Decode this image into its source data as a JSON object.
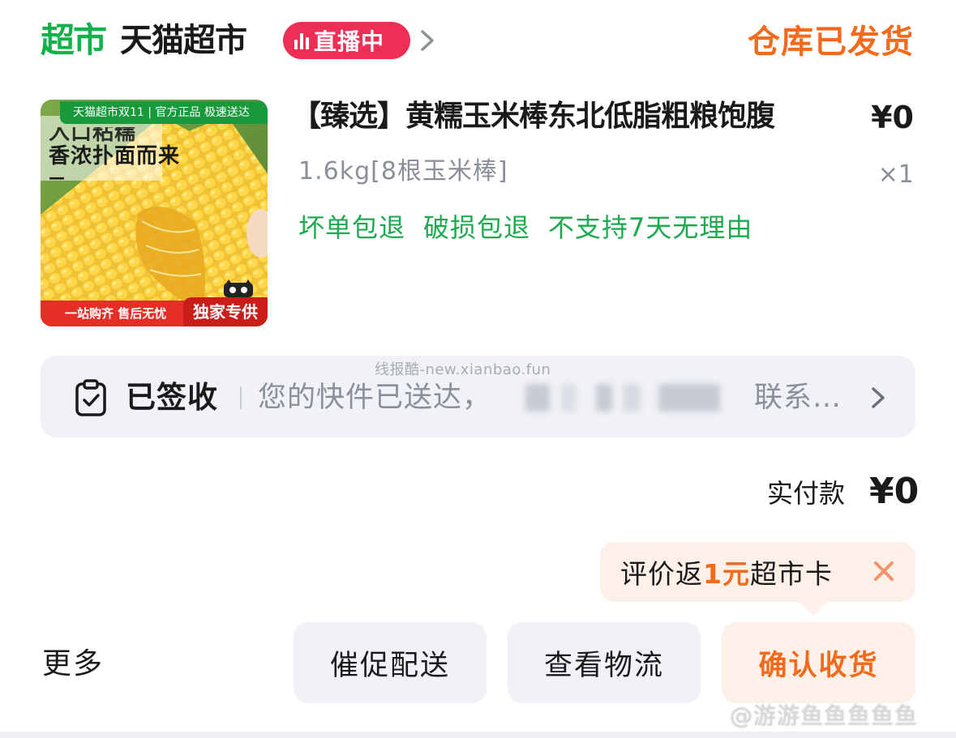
{
  "header": {
    "logo_text": "超市",
    "store_name": "天猫超市",
    "live_badge": "直播中",
    "order_status": "仓库已发货"
  },
  "product": {
    "image_top_tag": "天猫超市双11 | 官方正品  极速送达",
    "image_headline_1": "入口粘糯",
    "image_headline_2": "香浓扑面而来",
    "image_headline_3": "—",
    "image_bottom_text": "一站购齐  售后无忧",
    "image_exclusive": "独家专供",
    "title": "【臻选】黄糯玉米棒东北低脂粗粮饱腹",
    "price": "¥0",
    "spec": "1.6kg[8根玉米棒]",
    "quantity": "×1",
    "guarantees": [
      "坏单包退",
      "破损包退",
      "不支持7天无理由"
    ]
  },
  "watermark": "线报酷-new.xianbao.fun",
  "delivery": {
    "status": "已签收",
    "message": "您的快件已送达，",
    "contact": "联系…"
  },
  "payment": {
    "label": "实付款",
    "amount": "¥0"
  },
  "review_tip": {
    "prefix": "评价返",
    "highlight": "1元",
    "suffix": "超市卡"
  },
  "actions": {
    "more": "更多",
    "urge": "催促配送",
    "track": "查看物流",
    "confirm": "确认收货"
  },
  "weibo_watermark": "@游游鱼鱼鱼鱼鱼",
  "colors": {
    "brand_green": "#11b24a",
    "live_red": "#ee2f55",
    "accent_orange": "#f26b1d",
    "guarantee_green": "#1daa4e"
  },
  "icons": {
    "live": "live-bars-icon",
    "header_chevron": "chevron-right-icon",
    "delivery": "clipboard-check-icon",
    "delivery_chevron": "chevron-right-icon",
    "close": "close-icon"
  }
}
